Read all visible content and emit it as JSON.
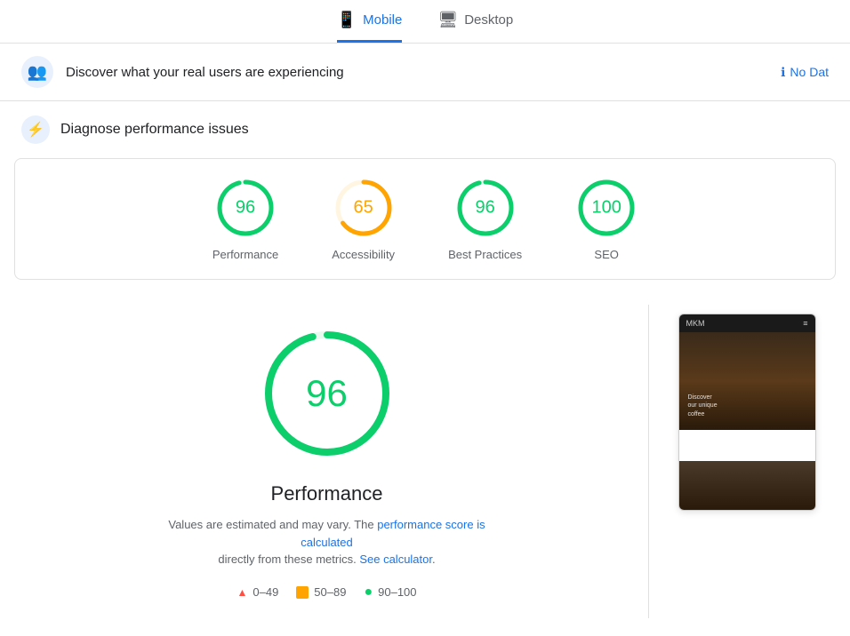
{
  "tabs": [
    {
      "id": "mobile",
      "label": "Mobile",
      "active": true,
      "icon": "📱"
    },
    {
      "id": "desktop",
      "label": "Desktop",
      "active": false,
      "icon": "🖥"
    }
  ],
  "discover": {
    "icon": "👥",
    "title": "Discover what your real users are experiencing",
    "no_data_icon": "ℹ",
    "no_data_label": "No Dat"
  },
  "diagnose": {
    "icon": "⚡",
    "title": "Diagnose performance issues"
  },
  "scores": [
    {
      "id": "performance",
      "label": "Performance",
      "value": 96,
      "color": "#0cce6b",
      "track": "#e8faf0"
    },
    {
      "id": "accessibility",
      "label": "Accessibility",
      "value": 65,
      "color": "#ffa400",
      "track": "#fff5e0"
    },
    {
      "id": "best-practices",
      "label": "Best Practices",
      "value": 96,
      "color": "#0cce6b",
      "track": "#e8faf0"
    },
    {
      "id": "seo",
      "label": "SEO",
      "value": 100,
      "color": "#0cce6b",
      "track": "#e8faf0"
    }
  ],
  "main_score": {
    "value": "96",
    "title": "Performance",
    "note_prefix": "Values are estimated and may vary. The ",
    "note_link1": "performance score is calculated",
    "note_mid": "directly from these metrics.",
    "note_link2": "See calculator",
    "note_suffix": "."
  },
  "legend": [
    {
      "id": "red",
      "range": "0–49"
    },
    {
      "id": "orange",
      "range": "50–89"
    },
    {
      "id": "green",
      "range": "90–100"
    }
  ],
  "phone_preview": {
    "brand": "MKM",
    "hero_text_line1": "Discover",
    "hero_text_line2": "our unique",
    "hero_text_line3": "coffee"
  }
}
